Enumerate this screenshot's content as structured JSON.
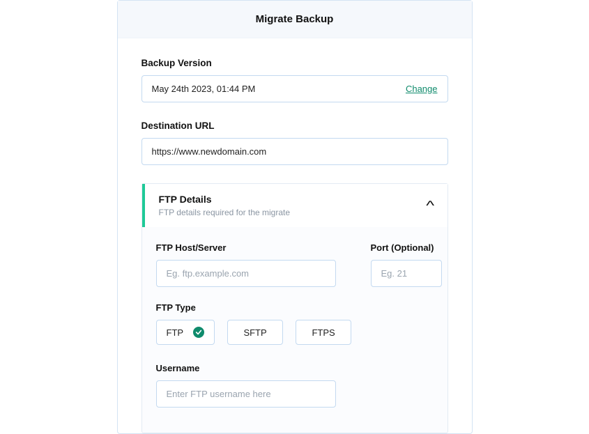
{
  "header": {
    "title": "Migrate Backup"
  },
  "backup": {
    "label": "Backup Version",
    "value": "May 24th 2023, 01:44 PM",
    "change_label": "Change"
  },
  "destination": {
    "label": "Destination URL",
    "value": "https://www.newdomain.com"
  },
  "ftp": {
    "title": "FTP Details",
    "subtitle": "FTP details required for the migrate",
    "host_label": "FTP Host/Server",
    "host_placeholder": "Eg. ftp.example.com",
    "port_label": "Port (Optional)",
    "port_placeholder": "Eg. 21",
    "type_label": "FTP Type",
    "types": {
      "ftp": "FTP",
      "sftp": "SFTP",
      "ftps": "FTPS"
    },
    "selected_type": "ftp",
    "username_label": "Username",
    "username_placeholder": "Enter FTP username here"
  }
}
